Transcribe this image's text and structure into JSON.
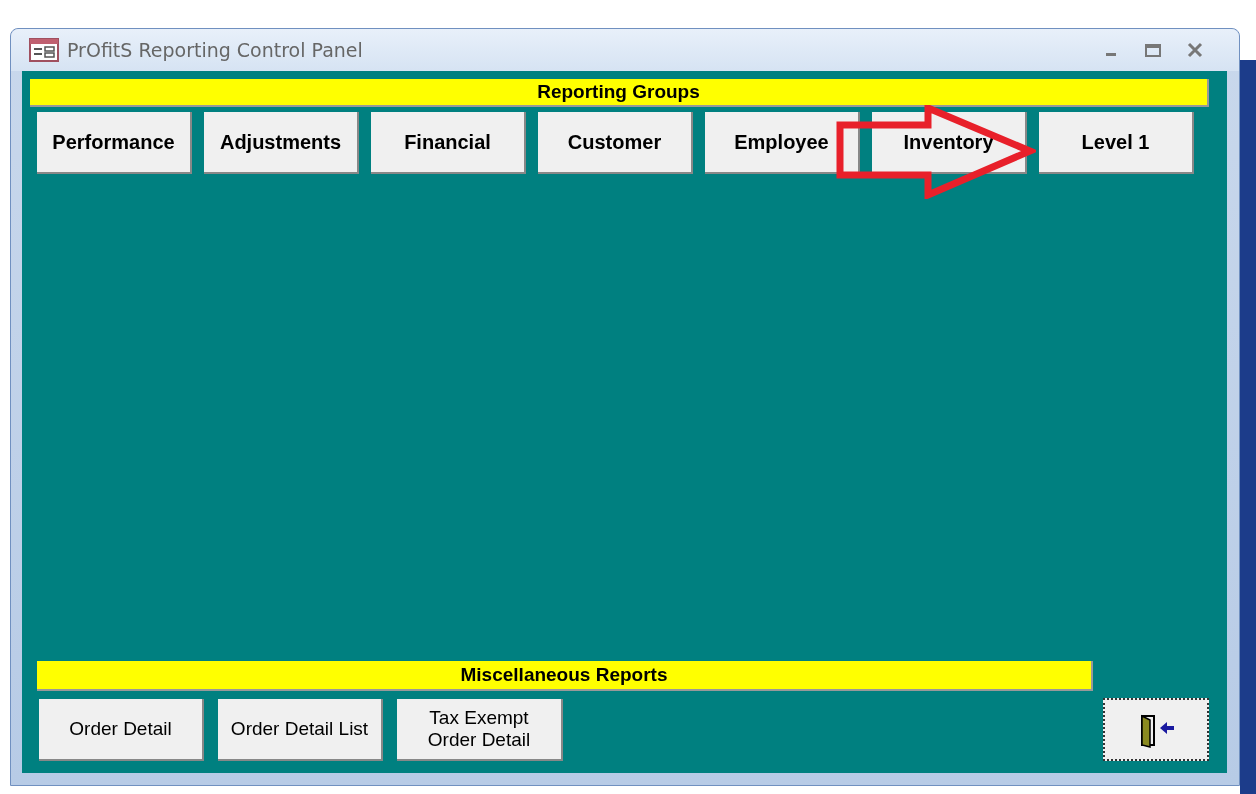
{
  "window": {
    "title": "PrOfitS Reporting Control Panel"
  },
  "reporting_groups": {
    "heading": "Reporting Groups",
    "buttons": [
      "Performance",
      "Adjustments",
      "Financial",
      "Customer",
      "Employee",
      "Inventory",
      "Level 1"
    ]
  },
  "annotation": {
    "kind": "arrow"
  },
  "miscellaneous_reports": {
    "heading": "Miscellaneous Reports",
    "buttons": [
      [
        "Order Detail"
      ],
      [
        "Order Detail List"
      ],
      [
        "Tax Exempt",
        "Order Detail"
      ]
    ]
  },
  "exit_button": {
    "kind": "door"
  }
}
